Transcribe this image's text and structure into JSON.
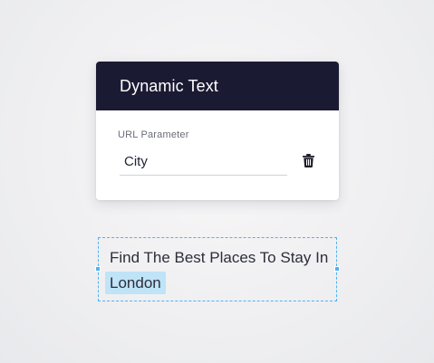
{
  "card": {
    "title": "Dynamic Text",
    "field_label": "URL Parameter",
    "field_value": "City",
    "delete_icon": "trash-icon"
  },
  "preview": {
    "text": "Find The Best Places To Stay In",
    "dynamic_value": "London"
  },
  "colors": {
    "header_bg": "#1b1a33",
    "accent": "#4fb2f0",
    "highlight": "#bfe3f7"
  }
}
